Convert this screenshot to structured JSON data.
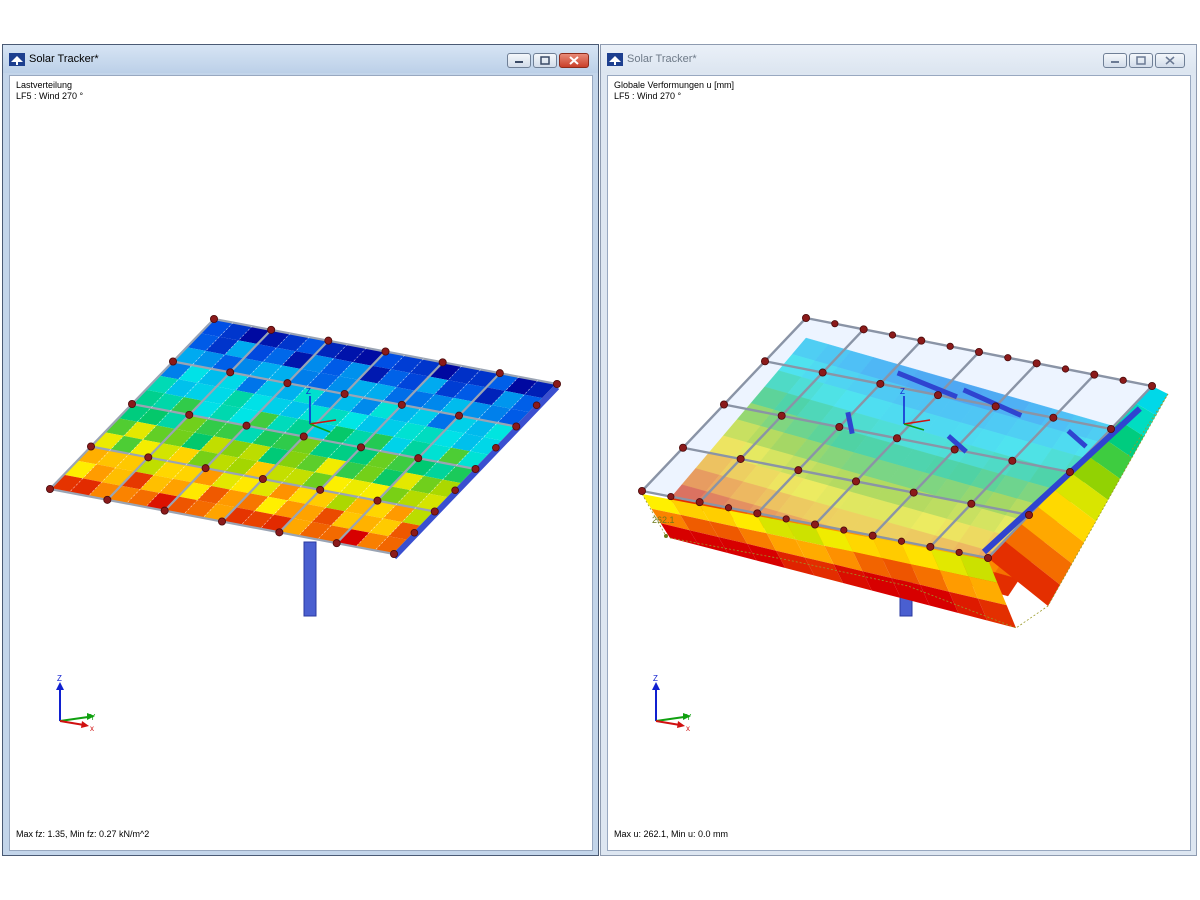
{
  "left_window": {
    "title": "Solar Tracker*",
    "result_type": "Lastverteilung",
    "load_case": "LF5 : Wind 270 °",
    "footer": "Max fz: 1.35, Min fz: 0.27 kN/m^2",
    "axis_labels": {
      "x": "x",
      "y": "Y",
      "z": "Z"
    },
    "active": true
  },
  "right_window": {
    "title": "Solar Tracker*",
    "result_type": "Globale Verformungen u [mm]",
    "load_case": "LF5 : Wind 270 °",
    "footer": "Max u: 262.1, Min u: 0.0 mm",
    "max_annotation": "262.1",
    "axis_labels": {
      "x": "x",
      "y": "Y",
      "z": "Z"
    },
    "active": false
  },
  "icons": [
    "app-icon",
    "minimize-icon",
    "maximize-icon",
    "close-icon"
  ],
  "colors": {
    "active_titlebar": "#bcd0e8",
    "inactive_titlebar": "#dce5f0",
    "close_button": "#c9402a",
    "member": "#4a5fd0",
    "node": "#8b1a1a"
  }
}
